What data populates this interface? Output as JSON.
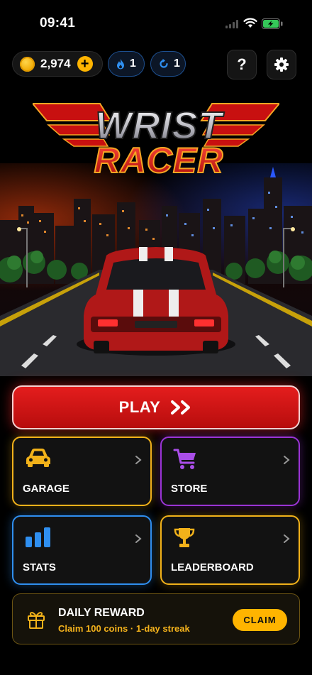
{
  "status": {
    "time": "09:41"
  },
  "header": {
    "coins": "2,974",
    "boost_fire": "1",
    "boost_refresh": "1",
    "help_label": "?"
  },
  "logo": {
    "line1": "WRIST",
    "line2": "RACER"
  },
  "play": {
    "label": "PLAY"
  },
  "tiles": {
    "garage": "GARAGE",
    "store": "STORE",
    "stats": "STATS",
    "leaderboard": "LEADERBOARD"
  },
  "daily": {
    "title": "DAILY REWARD",
    "subtitle": "Claim 100 coins · 1-day streak",
    "claim": "CLAIM"
  },
  "colors": {
    "accent_red": "#d81414",
    "gold": "#f2b21a",
    "purple": "#9b34d6",
    "blue": "#2f8ff0"
  },
  "icons": [
    "coin-icon",
    "plus-icon",
    "flame-icon",
    "refresh-icon",
    "help-icon",
    "gear-icon",
    "car-icon",
    "cart-icon",
    "bars-icon",
    "trophy-icon",
    "gift-icon",
    "chevron-right-icon",
    "double-chevron-icon"
  ]
}
